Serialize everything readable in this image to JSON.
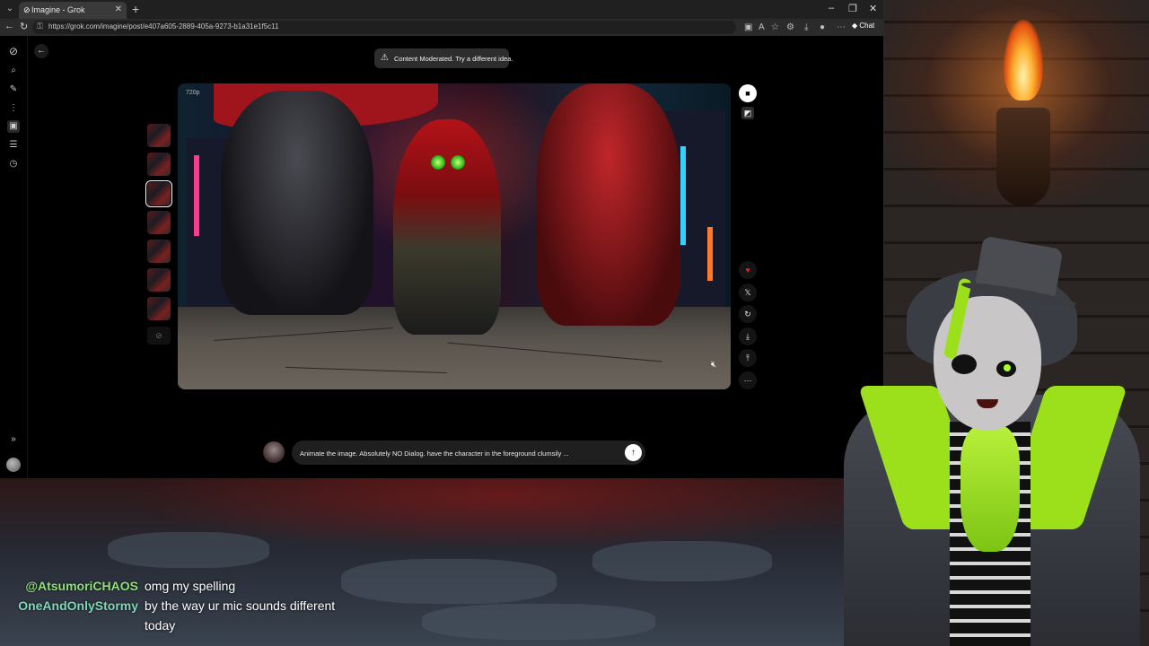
{
  "browser": {
    "tab_title": "Imagine - Grok",
    "url": "https://grok.com/imagine/post/e407a605-2889-405a-9273-b1a31e1f5c11",
    "copilot_label": "Chat"
  },
  "sidebar": {
    "icons": [
      "grok-logo-icon",
      "search-icon",
      "edit-icon",
      "voice-icon",
      "imagine-icon",
      "library-icon",
      "history-icon"
    ],
    "expand_icon": "chevrons-right-icon"
  },
  "toast": {
    "text": "Content Moderated. Try a different idea."
  },
  "image": {
    "resolution_badge": "720p"
  },
  "thumbnails": {
    "count": 7,
    "selected_index": 2
  },
  "prompt": {
    "text": "Animate the image. Absolutely NO Dialog. have the character in the foreground clumsily ..."
  },
  "chat": {
    "messages": [
      {
        "user": "@AtsumoriCHAOS",
        "text": "omg my spelling",
        "color": "#8fe07a"
      },
      {
        "user": "OneAndOnlyStormy",
        "text": "by the way ur mic sounds different",
        "continuation": "today",
        "color": "#7fd9b8"
      }
    ]
  },
  "colors": {
    "accent_green": "#9be01a",
    "like_red": "#e0212b"
  }
}
